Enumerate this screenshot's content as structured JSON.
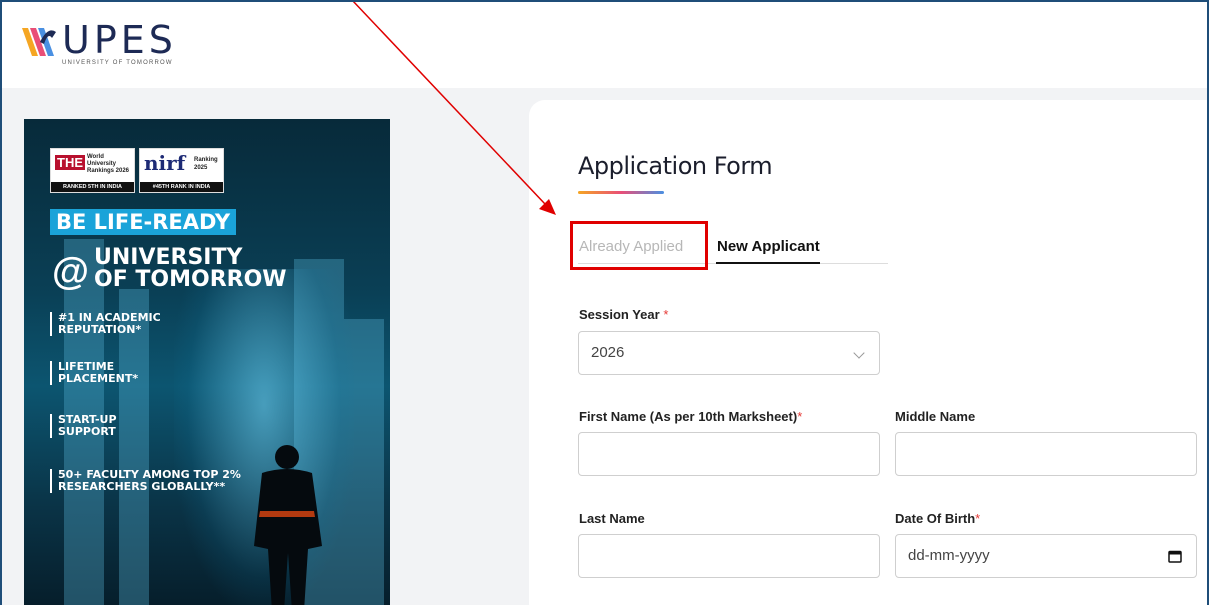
{
  "header": {
    "logo_text": "UPES",
    "logo_tagline": "UNIVERSITY OF TOMORROW"
  },
  "poster": {
    "badge_the": {
      "logo": "THE",
      "line1": "World",
      "line2": "University",
      "line3": "Rankings 2026",
      "foot": "RANKED 5TH IN INDIA"
    },
    "badge_nirf": {
      "logo": "nirf",
      "line1": "Ranking",
      "line2": "2025",
      "foot": "#45TH RANK IN INDIA"
    },
    "headline": "BE LIFE-READY",
    "at": "@",
    "uni_line1": "UNIVERSITY",
    "uni_line2": "OF TOMORROW",
    "features": [
      {
        "line1": "#1 IN ACADEMIC",
        "line2": "REPUTATION*"
      },
      {
        "line1": "LIFETIME",
        "line2": "PLACEMENT*"
      },
      {
        "line1": "START-UP",
        "line2": "SUPPORT"
      },
      {
        "line1": "50+ FACULTY AMONG TOP 2%",
        "line2": "RESEARCHERS GLOBALLY**"
      }
    ]
  },
  "form": {
    "title": "Application Form",
    "tabs": {
      "already_applied": "Already Applied",
      "new_applicant": "New Applicant"
    },
    "session_year": {
      "label": "Session Year",
      "required_mark": "*",
      "value": "2026"
    },
    "first_name": {
      "label": "First Name (As per 10th Marksheet)",
      "required_mark": "*",
      "value": ""
    },
    "middle_name": {
      "label": "Middle Name",
      "value": ""
    },
    "last_name": {
      "label": "Last Name",
      "value": ""
    },
    "dob": {
      "label": "Date Of Birth",
      "required_mark": "*",
      "placeholder": "dd-mm-yyyy"
    }
  },
  "colors": {
    "highlight": "#e00000",
    "arrow": "#e00000",
    "required": "#e53935",
    "brand_navy": "#1d2a55",
    "poster_accent": "#1aa3d9"
  }
}
